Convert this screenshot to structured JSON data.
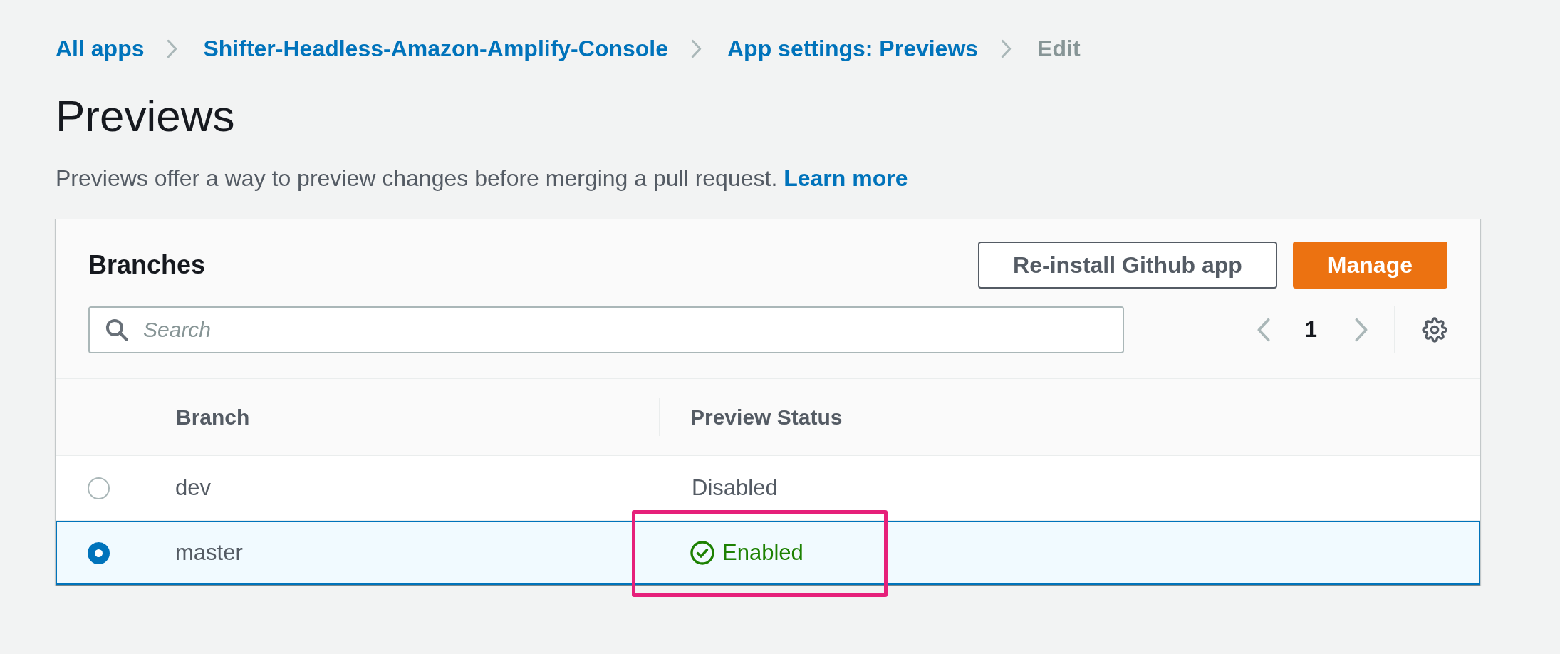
{
  "breadcrumbs": [
    {
      "label": "All apps",
      "current": false
    },
    {
      "label": "Shifter-Headless-Amazon-Amplify-Console",
      "current": false
    },
    {
      "label": "App settings: Previews",
      "current": false
    },
    {
      "label": "Edit",
      "current": true
    }
  ],
  "page": {
    "title": "Previews",
    "description": "Previews offer a way to preview changes before merging a pull request.",
    "link": "Learn more"
  },
  "card": {
    "title": "Branches",
    "buttons": [
      {
        "label": "Re-install Github app",
        "kind": "normal"
      },
      {
        "label": "Manage",
        "kind": "primary"
      }
    ],
    "search": {
      "placeholder": "Search"
    },
    "pagination": {
      "page": "1",
      "prev_disabled": true,
      "next_disabled": true
    }
  },
  "table": {
    "columns": [
      "Branch",
      "Preview Status"
    ],
    "rows": [
      {
        "branch": "dev",
        "status": {
          "label": "Disabled",
          "kind": "plain"
        },
        "selected": false,
        "highlighted": false
      },
      {
        "branch": "master",
        "status": {
          "label": "Enabled",
          "kind": "success"
        },
        "selected": true,
        "highlighted": true
      }
    ]
  }
}
